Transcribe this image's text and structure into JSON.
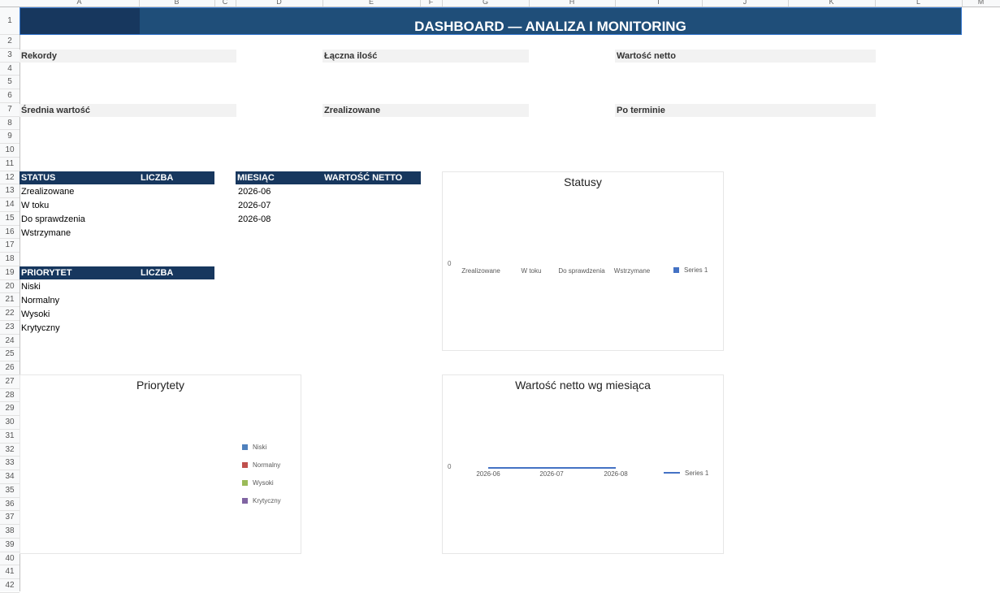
{
  "sheet": {
    "columns": [
      "A",
      "B",
      "C",
      "D",
      "E",
      "F",
      "G",
      "H",
      "I",
      "J",
      "K",
      "L",
      "M"
    ],
    "rows": [
      "1",
      "2",
      "3",
      "4",
      "5",
      "6",
      "7",
      "8",
      "9",
      "10",
      "11",
      "12",
      "13",
      "14",
      "15",
      "16",
      "17",
      "18",
      "19",
      "20",
      "21",
      "22",
      "23",
      "24",
      "25",
      "26",
      "27",
      "28",
      "29",
      "30",
      "31",
      "32",
      "33",
      "34",
      "35",
      "36",
      "37",
      "38",
      "39",
      "40",
      "41",
      "42"
    ]
  },
  "banner": {
    "title": "DASHBOARD — ANALIZA I MONITORING"
  },
  "kpis": {
    "records": "Rekordy",
    "total_qty": "Łączna ilość",
    "net_value": "Wartość netto",
    "avg_value": "Średnia wartość",
    "done": "Zrealizowane",
    "overdue": "Po terminie"
  },
  "status_table": {
    "headers": [
      "STATUS",
      "LICZBA"
    ],
    "rows": [
      "Zrealizowane",
      "W toku",
      "Do sprawdzenia",
      "Wstrzymane"
    ]
  },
  "month_table": {
    "headers": [
      "MIESIĄC",
      "WARTOŚĆ NETTO"
    ],
    "rows": [
      "2026-06",
      "2026-07",
      "2026-08"
    ]
  },
  "priority_table": {
    "headers": [
      "PRIORYTET",
      "LICZBA"
    ],
    "rows": [
      "Niski",
      "Normalny",
      "Wysoki",
      "Krytyczny"
    ]
  },
  "chart_data": [
    {
      "type": "bar",
      "title": "Statusy",
      "categories": [
        "Zrealizowane",
        "W toku",
        "Do sprawdzenia",
        "Wstrzymane"
      ],
      "series": [
        {
          "name": "Series 1",
          "values": [
            0,
            0,
            0,
            0
          ]
        }
      ],
      "y_tick": "0",
      "legend": "right",
      "colors": [
        "#4472c4"
      ]
    },
    {
      "type": "pie",
      "title": "Priorytety",
      "categories": [
        "Niski",
        "Normalny",
        "Wysoki",
        "Krytyczny"
      ],
      "values": [
        0,
        0,
        0,
        0
      ],
      "legend": "right",
      "colors": [
        "#4f81bd",
        "#c0504d",
        "#9bbb59",
        "#8064a2"
      ]
    },
    {
      "type": "line",
      "title": "Wartość netto wg miesiąca",
      "x": [
        "2026-06",
        "2026-07",
        "2026-08"
      ],
      "series": [
        {
          "name": "Series 1",
          "values": [
            0,
            0,
            0
          ]
        }
      ],
      "y_tick": "0",
      "legend": "right",
      "colors": [
        "#4472c4"
      ]
    }
  ]
}
